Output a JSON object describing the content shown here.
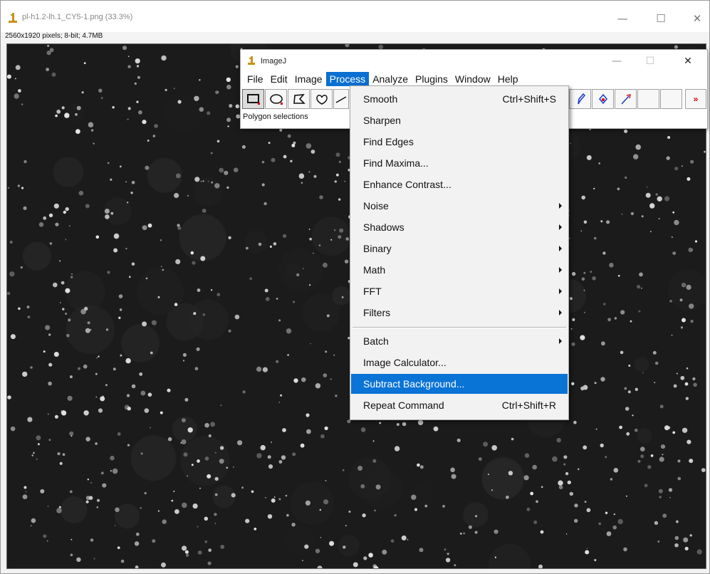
{
  "image_window": {
    "title": "pl-h1.2-lh.1_CY5-1.png (33.3%)",
    "info": "2560x1920 pixels; 8-bit; 4.7MB",
    "minimize": "—",
    "maximize": "☐",
    "close": "✕"
  },
  "imagej": {
    "title": "ImageJ",
    "minimize": "—",
    "maximize": "☐",
    "close": "✕",
    "menu": [
      {
        "label": "File"
      },
      {
        "label": "Edit"
      },
      {
        "label": "Image"
      },
      {
        "label": "Process",
        "active": true
      },
      {
        "label": "Analyze"
      },
      {
        "label": "Plugins"
      },
      {
        "label": "Window"
      },
      {
        "label": "Help"
      }
    ],
    "tools": [
      "rectangle-tool",
      "oval-tool",
      "polygon-tool",
      "freehand-tool",
      "line-tool",
      "pencil-tool",
      "dropper-tool",
      "wand-tool",
      "more-tools"
    ],
    "status": "Polygon selections"
  },
  "process_menu": {
    "items": [
      {
        "label": "Smooth",
        "shortcut": "Ctrl+Shift+S"
      },
      {
        "label": "Sharpen"
      },
      {
        "label": "Find Edges"
      },
      {
        "label": "Find Maxima..."
      },
      {
        "label": "Enhance Contrast..."
      },
      {
        "label": "Noise",
        "submenu": true
      },
      {
        "label": "Shadows",
        "submenu": true
      },
      {
        "label": "Binary",
        "submenu": true
      },
      {
        "label": "Math",
        "submenu": true
      },
      {
        "label": "FFT",
        "submenu": true
      },
      {
        "label": "Filters",
        "submenu": true
      },
      {
        "label": "Batch",
        "submenu": true
      },
      {
        "label": "Image Calculator..."
      },
      {
        "label": "Subtract Background...",
        "selected": true
      },
      {
        "label": "Repeat Command",
        "shortcut": "Ctrl+Shift+R"
      }
    ]
  },
  "colors": {
    "menu_highlight": "#0a6fd0",
    "image_background": "#1b1b1b",
    "imagej_icon": "#d4a017"
  }
}
